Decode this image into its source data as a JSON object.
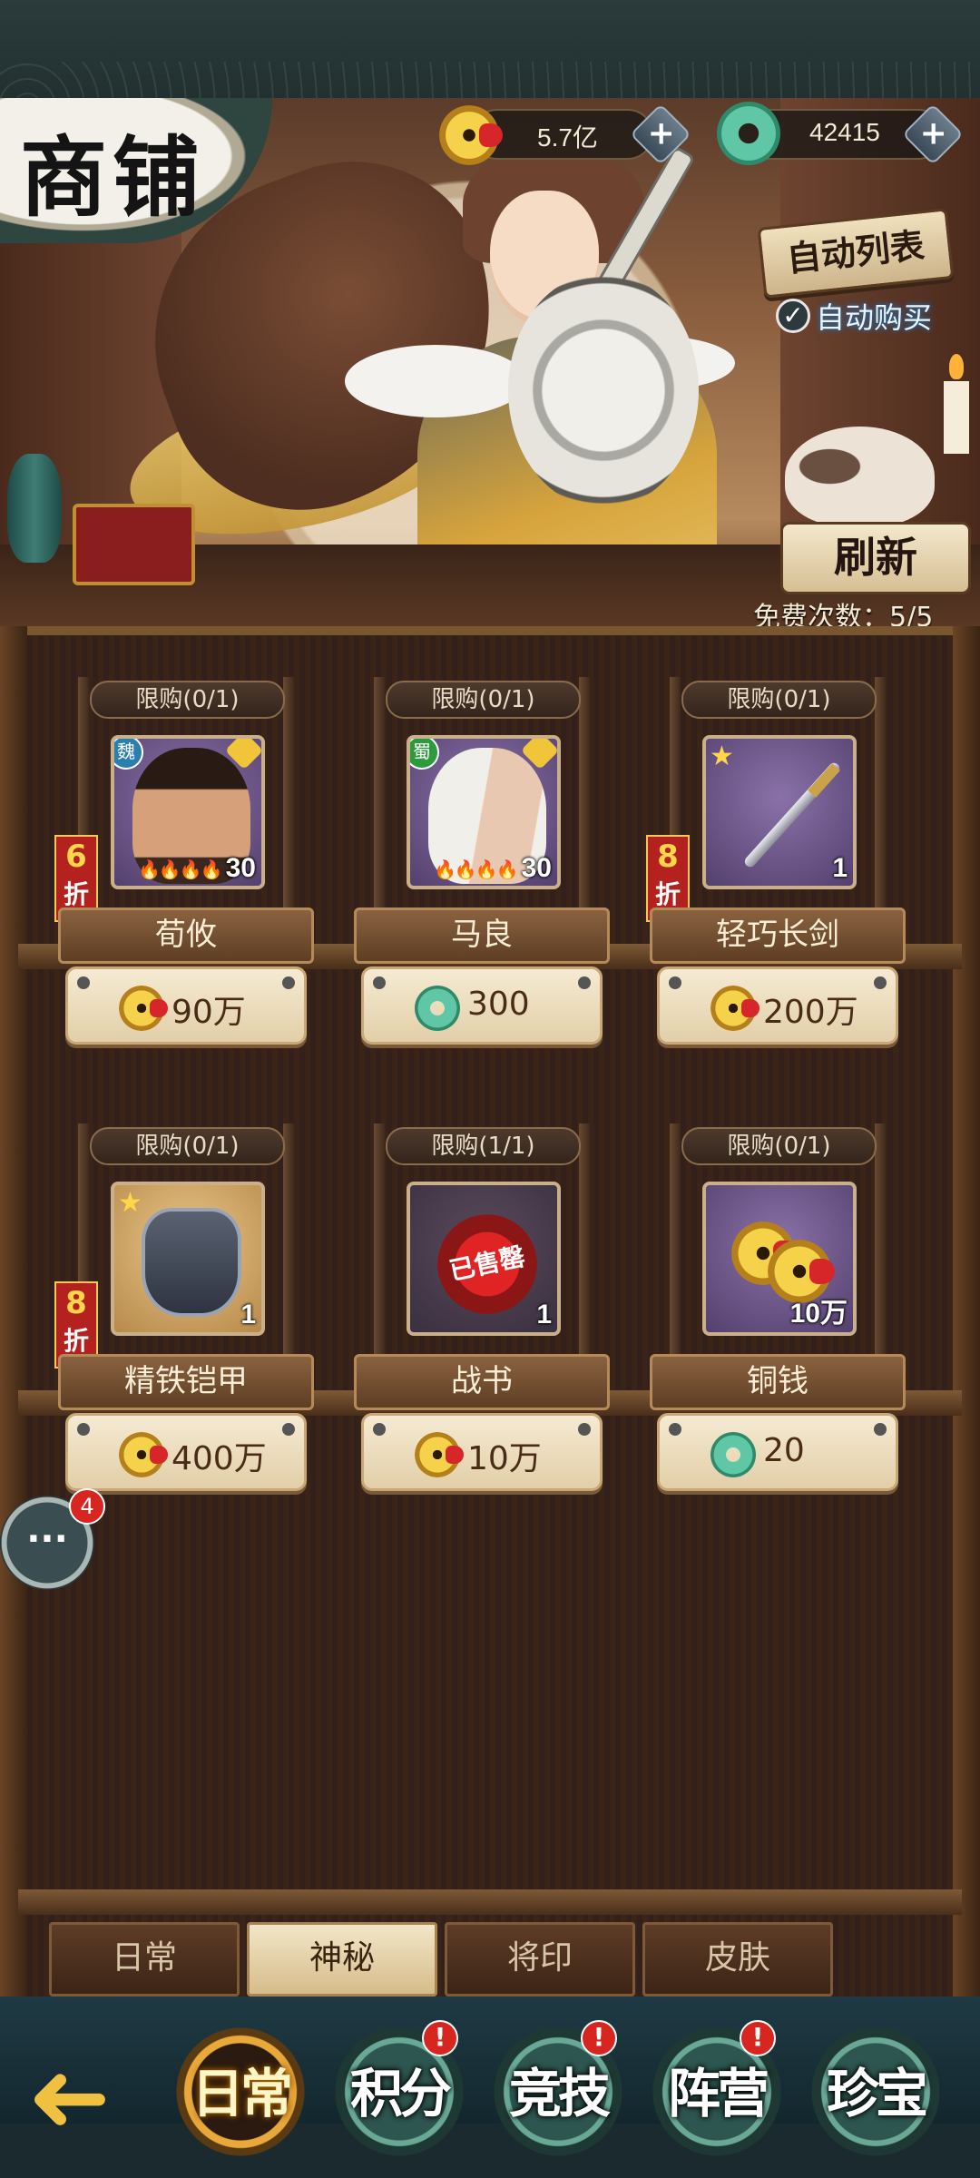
{
  "header": {
    "title": "商铺",
    "currencies": [
      {
        "icon": "copper-coin-icon",
        "value": "5.7亿"
      },
      {
        "icon": "jade-icon",
        "value": "42415"
      }
    ]
  },
  "controls": {
    "auto_list_label": "自动列表",
    "auto_buy_label": "自动购买",
    "auto_buy_checked": true,
    "refresh_label": "刷新",
    "free_count_label": "免费次数：",
    "free_count_value": "5/5"
  },
  "items": [
    {
      "limit": "限购(0/1)",
      "name": "荀攸",
      "qty": "30",
      "faction": "魏",
      "faction_color": "#2b7fb0",
      "discount_n": "6",
      "discount_z": "折",
      "price_icon": "copper-coin-icon",
      "price": "90万",
      "art": "portrait-general"
    },
    {
      "limit": "限购(0/1)",
      "name": "马良",
      "qty": "30",
      "faction": "蜀",
      "faction_color": "#2e9a3e",
      "discount_n": "",
      "discount_z": "",
      "price_icon": "jade-icon",
      "price": "300",
      "art": "portrait-scholar"
    },
    {
      "limit": "限购(0/1)",
      "name": "轻巧长剑",
      "qty": "1",
      "price_icon": "copper-coin-icon",
      "price": "200万",
      "discount_n": "8",
      "discount_z": "折",
      "art": "sword"
    },
    {
      "limit": "限购(0/1)",
      "name": "精铁铠甲",
      "qty": "1",
      "price_icon": "copper-coin-icon",
      "price": "400万",
      "discount_n": "8",
      "discount_z": "折",
      "art": "armor"
    },
    {
      "limit": "限购(1/1)",
      "name": "战书",
      "qty": "1",
      "price_icon": "copper-coin-icon",
      "price": "10万",
      "sold_out_label": "已售罄",
      "art": "war-letter"
    },
    {
      "limit": "限购(0/1)",
      "name": "铜钱",
      "qty": "10万",
      "price_icon": "jade-icon",
      "price": "20",
      "art": "coins"
    }
  ],
  "chat": {
    "badge": "4"
  },
  "tabs": [
    {
      "label": "日常",
      "active": false
    },
    {
      "label": "神秘",
      "active": true
    },
    {
      "label": "将印",
      "active": false
    },
    {
      "label": "皮肤",
      "active": false
    }
  ],
  "bottom_nav": [
    {
      "label": "日常",
      "active": true,
      "alert": ""
    },
    {
      "label": "积分",
      "active": false,
      "alert": "!"
    },
    {
      "label": "竞技",
      "active": false,
      "alert": "!"
    },
    {
      "label": "阵营",
      "active": false,
      "alert": "!"
    },
    {
      "label": "珍宝",
      "active": false,
      "alert": ""
    }
  ],
  "back_glyph": "➜"
}
